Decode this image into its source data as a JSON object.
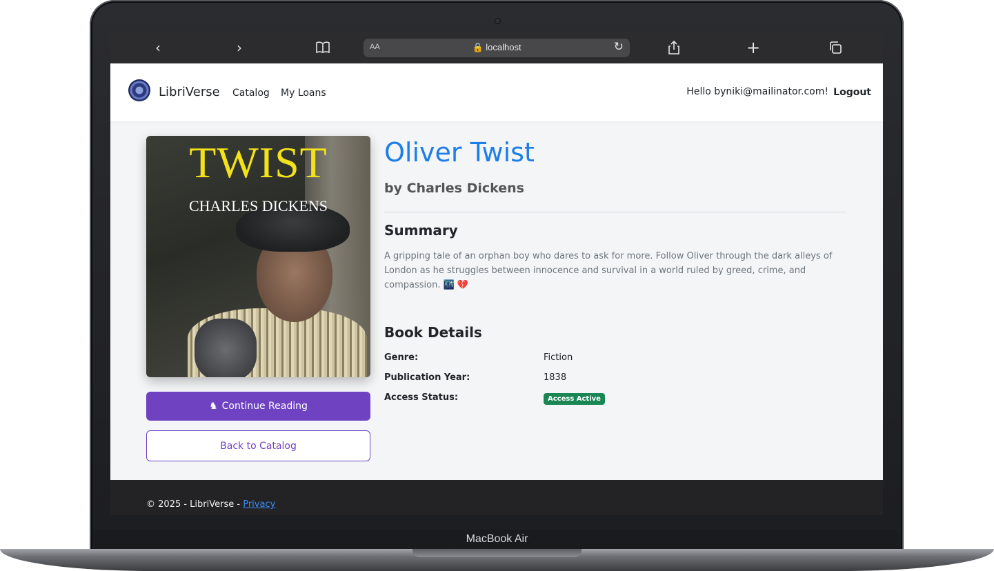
{
  "browser": {
    "reader_label": "AA",
    "url": "localhost",
    "icons": [
      "back-icon",
      "forward-icon",
      "bookmarks-icon",
      "lock-icon",
      "reload-icon",
      "share-icon",
      "new-tab-icon",
      "tabs-icon"
    ]
  },
  "navbar": {
    "brand": "LibriVerse",
    "links": [
      "Catalog",
      "My Loans"
    ],
    "greeting": "Hello byniki@mailinator.com!",
    "logout": "Logout"
  },
  "book": {
    "cover_title": "TWIST",
    "cover_author": "CHARLES DICKENS",
    "title": "Oliver Twist",
    "byline": "by Charles Dickens",
    "summary_heading": "Summary",
    "summary": "A gripping tale of an orphan boy who dares to ask for more. Follow Oliver through the dark alleys of London as he struggles between innocence and survival in a world ruled by greed, crime, and compassion. 🌃 💔",
    "details_heading": "Book Details",
    "details": [
      {
        "label": "Genre:",
        "value": "Fiction"
      },
      {
        "label": "Publication Year:",
        "value": "1838"
      },
      {
        "label": "Access Status:",
        "value": "Access Active"
      }
    ]
  },
  "actions": {
    "continue_label": "Continue Reading",
    "back_label": "Back to Catalog"
  },
  "footer": {
    "copyright": "© 2025 - LibriVerse - ",
    "privacy": "Privacy"
  },
  "device": {
    "model": "MacBook Air"
  },
  "colors": {
    "accent": "#6f42c1",
    "title": "#1e7ee8",
    "badge": "#198754"
  }
}
